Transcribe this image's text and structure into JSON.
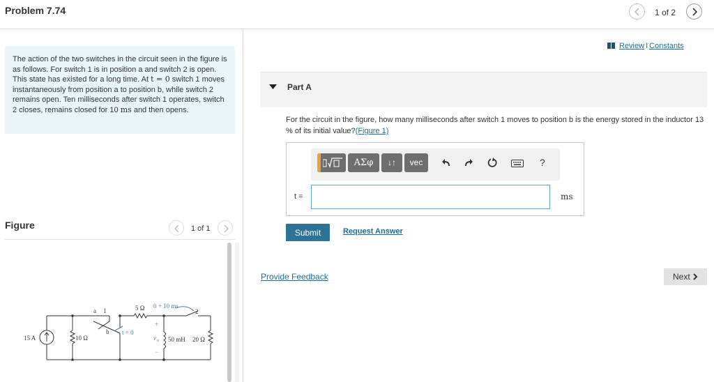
{
  "header": {
    "title": "Problem 7.74",
    "page_counter": "1 of 2"
  },
  "problem": {
    "statement_parts": [
      "The action of the two switches in the circuit seen in the figure is as follows. For switch 1 is in position a and switch 2 is open. This state has existed for a long time. At ",
      "t = 0",
      " switch 1 moves instantaneously from position a to position b, while switch 2 remains open. Ten milliseconds after switch 1 operates, switch 2 closes, remains closed for 10 ",
      "ms",
      " and then opens."
    ]
  },
  "figure": {
    "label": "Figure",
    "counter": "1 of 1",
    "circuit": {
      "source": "15 A",
      "r1": "10 Ω",
      "r2": "5 Ω",
      "timing": "0 + 10 ms",
      "switch_label": "2",
      "node_a": "a",
      "node_b": "b",
      "switch1": "1",
      "t0": "t = 0",
      "voltage": "v",
      "voltage_sub": "o",
      "plus": "+",
      "minus": "−",
      "inductor": "50 mH",
      "r3": "20 Ω"
    }
  },
  "links": {
    "review": "Review",
    "separator": "I",
    "constants": "Constants"
  },
  "part": {
    "title": "Part A",
    "question_text": "For the circuit in the figure, how many milliseconds after switch 1 moves to position b is the energy stored in the inductor 13 % of its initial value?",
    "figure_link": "(Figure 1)"
  },
  "toolbar": {
    "symbols_label": "ΑΣφ",
    "arrows_label": "↓↑",
    "vec_label": "vec",
    "help_label": "?"
  },
  "answer": {
    "variable_label": "t =",
    "value": "",
    "placeholder": "",
    "unit": "ms"
  },
  "actions": {
    "submit": "Submit",
    "request_answer": "Request Answer",
    "provide_feedback": "Provide Feedback",
    "next": "Next"
  },
  "colors": {
    "accent": "#2e7298",
    "link": "#1a6e96",
    "statement_bg": "#e9f5f9",
    "toolbar_button": "#6e6e6e",
    "template_indicator": "#e9a23b"
  }
}
